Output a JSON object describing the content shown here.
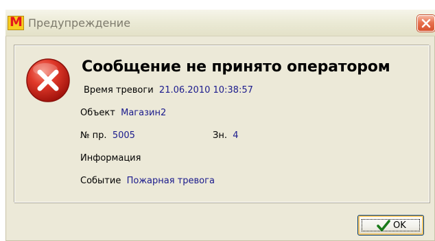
{
  "window": {
    "title": "Предупреждение",
    "app_icon_letter": "M",
    "app_icon_name": "app-logo-icon",
    "close_icon_name": "close-icon"
  },
  "message": {
    "heading": "Сообщение не принято оператором",
    "icon_name": "error-icon"
  },
  "fields": {
    "alarm_time_label": "Время тревоги",
    "alarm_time_value": "21.06.2010 10:38:57",
    "object_label": "Объект",
    "object_value": "Магазин2",
    "number_label": "№ пр.",
    "number_value": "5005",
    "zone_label": "Зн.",
    "zone_value": "4",
    "info_label": "Информация",
    "event_label": "Событие",
    "event_value": "Пожарная тревога"
  },
  "buttons": {
    "ok_label": "OK",
    "ok_icon_name": "checkmark-icon"
  },
  "colors": {
    "value_text": "#1a1a8c",
    "dialog_bg": "#ece9d8",
    "error_red": "#d42a1c",
    "close_button": "#d8532f"
  }
}
